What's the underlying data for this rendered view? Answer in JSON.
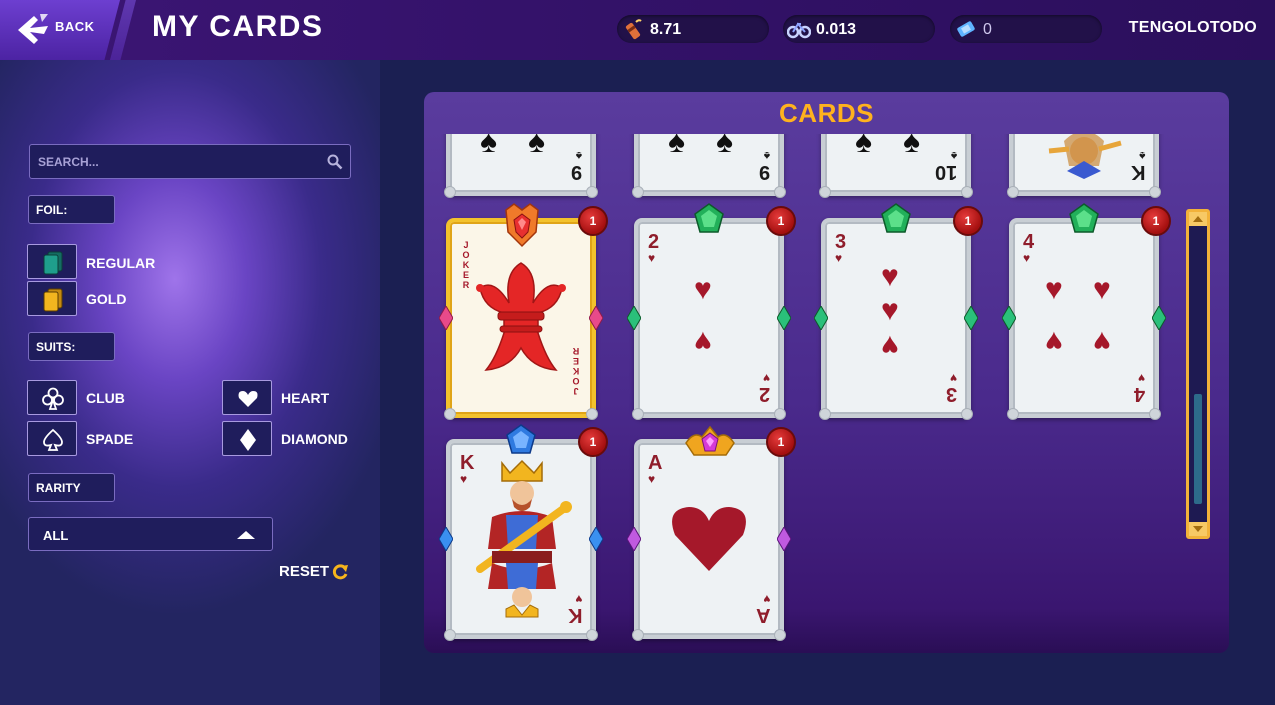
{
  "header": {
    "back_label": "BACK",
    "title": "MY CARDS",
    "stats": [
      {
        "icon": "dynamite-icon",
        "value": "8.71"
      },
      {
        "icon": "bicycle-token-icon",
        "value": "0.013"
      },
      {
        "icon": "ticket-icon",
        "value": "0"
      }
    ],
    "username": "TENGOLOTODO"
  },
  "filters": {
    "search_placeholder": "SEARCH...",
    "foil_label": "FOIL:",
    "foil_options": [
      {
        "label": "REGULAR",
        "color": "#1f9e8c"
      },
      {
        "label": "GOLD",
        "color": "#f2b51f"
      }
    ],
    "suits_label": "SUITS:",
    "suit_options": [
      {
        "label": "CLUB"
      },
      {
        "label": "HEART"
      },
      {
        "label": "SPADE"
      },
      {
        "label": "DIAMOND"
      }
    ],
    "rarity_label": "RARITY",
    "rarity_value": "ALL",
    "reset_label": "RESET"
  },
  "cards_panel": {
    "title": "CARDS",
    "cards": [
      {
        "rank": "9",
        "suit": "spade",
        "count": null,
        "gem": null
      },
      {
        "rank": "9",
        "suit": "spade",
        "count": null,
        "gem": null
      },
      {
        "rank": "10",
        "suit": "spade",
        "count": null,
        "gem": null
      },
      {
        "rank": "K",
        "suit": "spade",
        "count": null,
        "gem": null
      },
      {
        "rank": "JOKER",
        "suit": "joker",
        "count": "1",
        "gem": "red-crown"
      },
      {
        "rank": "2",
        "suit": "heart",
        "count": "1",
        "gem": "green"
      },
      {
        "rank": "3",
        "suit": "heart",
        "count": "1",
        "gem": "green"
      },
      {
        "rank": "4",
        "suit": "heart",
        "count": "1",
        "gem": "green"
      },
      {
        "rank": "K",
        "suit": "heart",
        "count": "1",
        "gem": "blue"
      },
      {
        "rank": "A",
        "suit": "heart",
        "count": "1",
        "gem": "pink-crown"
      }
    ]
  },
  "colors": {
    "accent_gold": "#ffb21e",
    "heart_red": "#a5182a",
    "badge_red": "#c31a1a"
  }
}
